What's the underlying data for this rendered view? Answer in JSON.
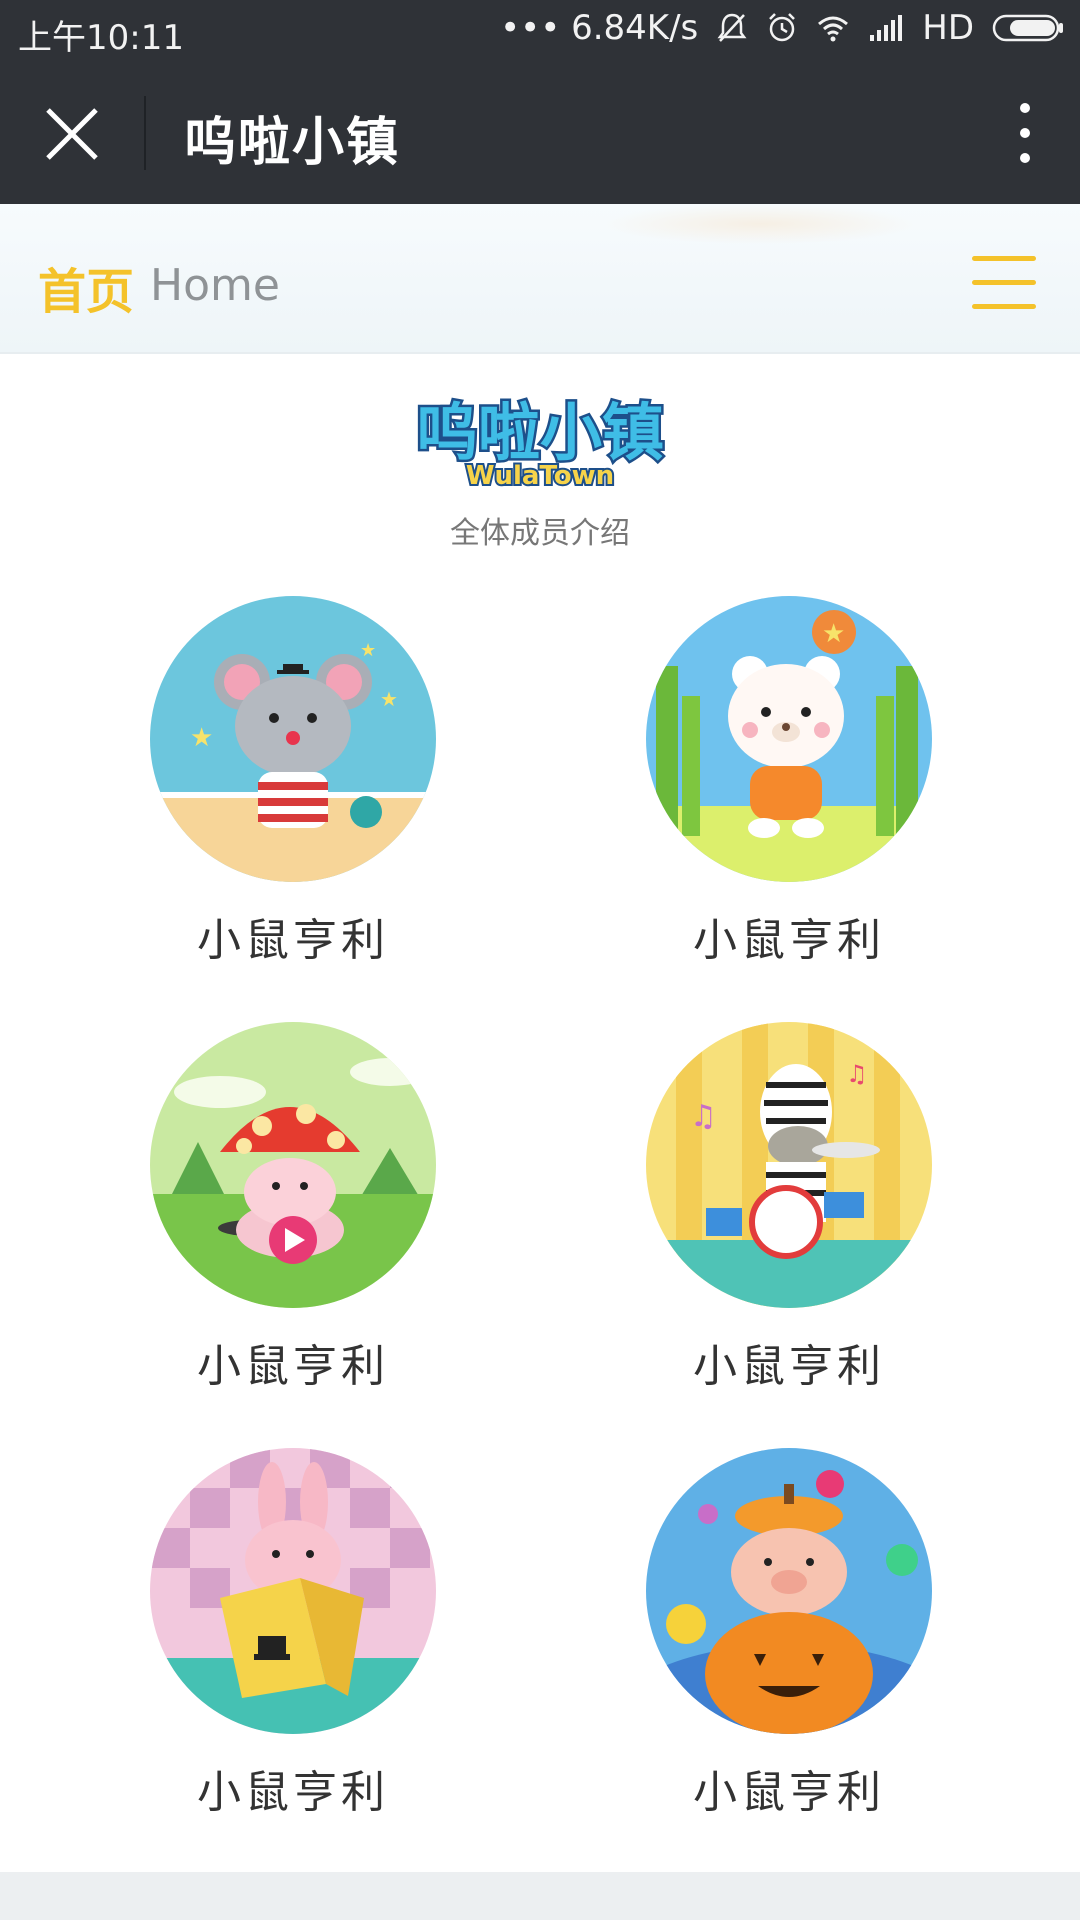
{
  "status_bar": {
    "time": "上午10:11",
    "net_speed": "••• 6.84K/s",
    "network": "HD"
  },
  "titlebar": {
    "title": "呜啦小镇",
    "close_icon": "close-icon",
    "more_icon": "more-vertical-icon"
  },
  "nav": {
    "title_cn": "首页",
    "title_en": "Home",
    "menu_icon": "hamburger-menu-icon"
  },
  "logo": {
    "text": "呜啦小镇",
    "subtext": "WulaTown"
  },
  "intro": "全体成员介绍",
  "members": [
    {
      "name": "小鼠亨利",
      "icon": "mouse-character-icon"
    },
    {
      "name": "小鼠亨利",
      "icon": "bear-character-icon"
    },
    {
      "name": "小鼠亨利",
      "icon": "mushroom-character-icon"
    },
    {
      "name": "小鼠亨利",
      "icon": "zebra-drummer-icon"
    },
    {
      "name": "小鼠亨利",
      "icon": "rabbit-magic-book-icon"
    },
    {
      "name": "小鼠亨利",
      "icon": "pig-pumpkin-icon"
    }
  ],
  "colors": {
    "bar_bg": "#2f3237",
    "accent": "#f4c22a"
  }
}
